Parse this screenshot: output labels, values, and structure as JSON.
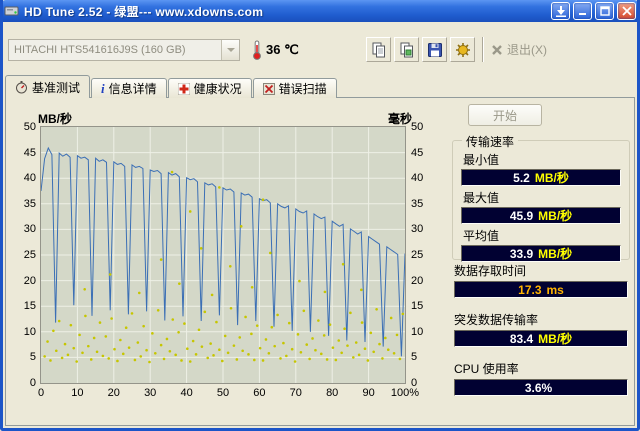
{
  "window": {
    "title": "HD Tune 2.52 - 绿盟--- www.xdowns.com"
  },
  "toolbar": {
    "drive": "HITACHI HTS541616J9S (160 GB)",
    "temperature": "36 ℃",
    "exit": "退出(X)"
  },
  "tabs": [
    {
      "label": "基准测试"
    },
    {
      "label": "信息详情"
    },
    {
      "label": "健康状况"
    },
    {
      "label": "错误扫描"
    }
  ],
  "panel": {
    "start": "开始",
    "group_title": "传输速率",
    "stats": [
      {
        "label": "最小值",
        "value": "5.2",
        "unit": "MB/秒",
        "value_color": "#ffffff",
        "unit_color": "#ffff00"
      },
      {
        "label": "最大值",
        "value": "45.9",
        "unit": "MB/秒",
        "value_color": "#ffffff",
        "unit_color": "#ffff00"
      },
      {
        "label": "平均值",
        "value": "33.9",
        "unit": "MB/秒",
        "value_color": "#ffffff",
        "unit_color": "#ffff00"
      }
    ],
    "extras": [
      {
        "label": "数据存取时间",
        "value": "17.3",
        "unit": "ms",
        "value_color": "#ffb400",
        "unit_color": "#ffb400"
      },
      {
        "label": "突发数据传输率",
        "value": "83.4",
        "unit": "MB/秒",
        "value_color": "#ffffff",
        "unit_color": "#ffff00"
      },
      {
        "label": "CPU 使用率",
        "value": "3.6%",
        "unit": "",
        "value_color": "#ffffff",
        "unit_color": "#ffff00"
      }
    ]
  },
  "chart_data": {
    "type": "line",
    "title": "",
    "left_axis_label": "MB/秒",
    "right_axis_label": "毫秒",
    "xlim": [
      0,
      100
    ],
    "ylim": [
      0,
      50
    ],
    "x_ticks": [
      "0",
      "10",
      "20",
      "30",
      "40",
      "50",
      "60",
      "70",
      "80",
      "90",
      "100%"
    ],
    "y_ticks_left": [
      50,
      45,
      40,
      35,
      30,
      25,
      20,
      15,
      10,
      5,
      0
    ],
    "y_ticks_right": [
      50,
      45,
      40,
      35,
      30,
      25,
      20,
      15,
      10,
      5,
      0
    ],
    "grid": true,
    "grid_color": "#eef0e6",
    "bg_color": "#d4d8c8",
    "series": [
      {
        "name": "transfer-rate",
        "type": "line",
        "color": "#3b6fb5",
        "points": [
          [
            0,
            37.5
          ],
          [
            1,
            43.8
          ],
          [
            2,
            45.9
          ],
          [
            3,
            44.6
          ],
          [
            4,
            11.8
          ],
          [
            5,
            44.9
          ],
          [
            6,
            44.3
          ],
          [
            7,
            44.7
          ],
          [
            8,
            44.1
          ],
          [
            9,
            15.2
          ],
          [
            10,
            44.4
          ],
          [
            11,
            43.9
          ],
          [
            12,
            44.1
          ],
          [
            13,
            43.6
          ],
          [
            14,
            13.1
          ],
          [
            15,
            43.9
          ],
          [
            16,
            43.3
          ],
          [
            17,
            43.6
          ],
          [
            18,
            43.1
          ],
          [
            19,
            14.2
          ],
          [
            20,
            43.2
          ],
          [
            21,
            42.7
          ],
          [
            22,
            42.9
          ],
          [
            23,
            42.3
          ],
          [
            24,
            13.4
          ],
          [
            25,
            42.6
          ],
          [
            26,
            42.1
          ],
          [
            27,
            42.3
          ],
          [
            28,
            41.9
          ],
          [
            29,
            14.0
          ],
          [
            30,
            41.6
          ],
          [
            31,
            41.3
          ],
          [
            32,
            41.5
          ],
          [
            33,
            40.9
          ],
          [
            34,
            12.2
          ],
          [
            35,
            41.1
          ],
          [
            36,
            40.6
          ],
          [
            37,
            40.9
          ],
          [
            38,
            40.3
          ],
          [
            39,
            13.0
          ],
          [
            40,
            40.1
          ],
          [
            41,
            39.7
          ],
          [
            42,
            39.9
          ],
          [
            43,
            39.3
          ],
          [
            44,
            12.1
          ],
          [
            45,
            39.1
          ],
          [
            46,
            38.7
          ],
          [
            47,
            38.9
          ],
          [
            48,
            38.3
          ],
          [
            49,
            13.2
          ],
          [
            50,
            38.1
          ],
          [
            51,
            37.7
          ],
          [
            52,
            37.9
          ],
          [
            53,
            37.3
          ],
          [
            54,
            11.3
          ],
          [
            55,
            37.1
          ],
          [
            56,
            36.7
          ],
          [
            57,
            36.9
          ],
          [
            58,
            36.3
          ],
          [
            59,
            12.1
          ],
          [
            60,
            36.0
          ],
          [
            61,
            35.6
          ],
          [
            62,
            35.8
          ],
          [
            63,
            35.2
          ],
          [
            64,
            11.0
          ],
          [
            65,
            35.0
          ],
          [
            66,
            34.5
          ],
          [
            67,
            34.2
          ],
          [
            68,
            34.6
          ],
          [
            69,
            10.2
          ],
          [
            70,
            34.0
          ],
          [
            71,
            33.5
          ],
          [
            72,
            33.2
          ],
          [
            73,
            33.6
          ],
          [
            74,
            10.0
          ],
          [
            75,
            33.0
          ],
          [
            76,
            32.5
          ],
          [
            77,
            32.1
          ],
          [
            78,
            32.4
          ],
          [
            79,
            9.2
          ],
          [
            80,
            31.6
          ],
          [
            81,
            31.1
          ],
          [
            82,
            30.6
          ],
          [
            83,
            31.0
          ],
          [
            84,
            8.3
          ],
          [
            85,
            30.1
          ],
          [
            86,
            29.6
          ],
          [
            87,
            29.1
          ],
          [
            88,
            29.5
          ],
          [
            89,
            8.0
          ],
          [
            90,
            28.6
          ],
          [
            91,
            28.1
          ],
          [
            92,
            27.6
          ],
          [
            93,
            27.1
          ],
          [
            94,
            7.1
          ],
          [
            95,
            26.6
          ],
          [
            96,
            26.1
          ],
          [
            97,
            25.6
          ],
          [
            98,
            25.1
          ],
          [
            99,
            5.2
          ],
          [
            100,
            25.3
          ]
        ]
      },
      {
        "name": "access-time",
        "type": "scatter",
        "color": "#c6c600",
        "points": [
          [
            1,
            5.2
          ],
          [
            1.8,
            8.1
          ],
          [
            2.6,
            4.4
          ],
          [
            3.4,
            10.2
          ],
          [
            4.2,
            6.3
          ],
          [
            5,
            12.1
          ],
          [
            5.8,
            4.9
          ],
          [
            6.6,
            7.6
          ],
          [
            7.4,
            5.5
          ],
          [
            8.2,
            11.3
          ],
          [
            9,
            6.8
          ],
          [
            9.8,
            4.2
          ],
          [
            10.6,
            9.4
          ],
          [
            11.4,
            5.9
          ],
          [
            12.2,
            13.1
          ],
          [
            13,
            7.2
          ],
          [
            13.8,
            4.6
          ],
          [
            14.6,
            8.8
          ],
          [
            15.4,
            6.1
          ],
          [
            16.2,
            11.8
          ],
          [
            17,
            5.3
          ],
          [
            17.8,
            9.1
          ],
          [
            18.6,
            4.8
          ],
          [
            19.4,
            12.6
          ],
          [
            20.2,
            6.6
          ],
          [
            21,
            4.3
          ],
          [
            21.8,
            8.4
          ],
          [
            22.6,
            5.7
          ],
          [
            23.4,
            10.8
          ],
          [
            24.2,
            6.9
          ],
          [
            25,
            13.6
          ],
          [
            25.8,
            4.5
          ],
          [
            26.6,
            7.9
          ],
          [
            27.4,
            5.2
          ],
          [
            28.2,
            11.1
          ],
          [
            29,
            6.4
          ],
          [
            29.8,
            4.1
          ],
          [
            30.6,
            9.7
          ],
          [
            31.4,
            5.8
          ],
          [
            32.2,
            14.2
          ],
          [
            33,
            7.4
          ],
          [
            33.8,
            4.7
          ],
          [
            34.6,
            8.6
          ],
          [
            35.4,
            6.2
          ],
          [
            36.2,
            12.4
          ],
          [
            37,
            5.5
          ],
          [
            37.8,
            9.9
          ],
          [
            38.6,
            4.4
          ],
          [
            39.4,
            11.6
          ],
          [
            40.2,
            6.7
          ],
          [
            41,
            4.2
          ],
          [
            41.8,
            8.2
          ],
          [
            42.6,
            5.6
          ],
          [
            43.4,
            10.4
          ],
          [
            44.2,
            7.1
          ],
          [
            45,
            13.9
          ],
          [
            45.8,
            4.9
          ],
          [
            46.6,
            7.7
          ],
          [
            47.4,
            5.4
          ],
          [
            48.2,
            11.9
          ],
          [
            49,
            6.5
          ],
          [
            49.8,
            4.3
          ],
          [
            50.6,
            9.2
          ],
          [
            51.4,
            5.9
          ],
          [
            52.2,
            14.6
          ],
          [
            53,
            7.3
          ],
          [
            53.8,
            4.6
          ],
          [
            54.6,
            8.9
          ],
          [
            55.4,
            6.3
          ],
          [
            56.2,
            12.9
          ],
          [
            57,
            5.6
          ],
          [
            57.8,
            9.6
          ],
          [
            58.6,
            4.5
          ],
          [
            59.4,
            11.2
          ],
          [
            60.2,
            6.8
          ],
          [
            61,
            4.4
          ],
          [
            61.8,
            8.5
          ],
          [
            62.6,
            5.8
          ],
          [
            63.4,
            10.9
          ],
          [
            64.2,
            7.2
          ],
          [
            65,
            13.3
          ],
          [
            65.8,
            4.8
          ],
          [
            66.6,
            7.8
          ],
          [
            67.4,
            5.3
          ],
          [
            68.2,
            11.7
          ],
          [
            69,
            6.6
          ],
          [
            69.8,
            4.2
          ],
          [
            70.6,
            9.5
          ],
          [
            71.4,
            6.0
          ],
          [
            72.2,
            14.1
          ],
          [
            73,
            7.5
          ],
          [
            73.8,
            4.7
          ],
          [
            74.6,
            8.7
          ],
          [
            75.4,
            6.4
          ],
          [
            76.2,
            12.2
          ],
          [
            77,
            5.7
          ],
          [
            77.8,
            9.3
          ],
          [
            78.6,
            4.6
          ],
          [
            79.4,
            11.4
          ],
          [
            80.2,
            6.9
          ],
          [
            81,
            4.5
          ],
          [
            81.8,
            8.3
          ],
          [
            82.6,
            5.9
          ],
          [
            83.4,
            10.6
          ],
          [
            84.2,
            7.3
          ],
          [
            85,
            13.7
          ],
          [
            85.8,
            5.0
          ],
          [
            86.6,
            7.9
          ],
          [
            87.4,
            5.5
          ],
          [
            88.2,
            11.8
          ],
          [
            89,
            6.7
          ],
          [
            89.8,
            4.4
          ],
          [
            90.6,
            9.8
          ],
          [
            91.4,
            6.1
          ],
          [
            92.2,
            14.4
          ],
          [
            93,
            7.6
          ],
          [
            93.8,
            4.8
          ],
          [
            94.6,
            8.8
          ],
          [
            95.4,
            6.5
          ],
          [
            96.2,
            12.7
          ],
          [
            97,
            5.8
          ],
          [
            97.8,
            9.4
          ],
          [
            98.6,
            4.7
          ],
          [
            99.4,
            13.5
          ],
          [
            12,
            18.3
          ],
          [
            19,
            21.2
          ],
          [
            27,
            17.6
          ],
          [
            33,
            24.1
          ],
          [
            38,
            19.4
          ],
          [
            44,
            26.3
          ],
          [
            47,
            17.2
          ],
          [
            52,
            22.8
          ],
          [
            58,
            18.7
          ],
          [
            63,
            25.4
          ],
          [
            71,
            19.9
          ],
          [
            78,
            17.8
          ],
          [
            83,
            23.2
          ],
          [
            88,
            18.2
          ],
          [
            36,
            41.2
          ],
          [
            41,
            33.5
          ],
          [
            49,
            38.2
          ],
          [
            55,
            30.6
          ],
          [
            61,
            35.8
          ]
        ]
      }
    ]
  }
}
